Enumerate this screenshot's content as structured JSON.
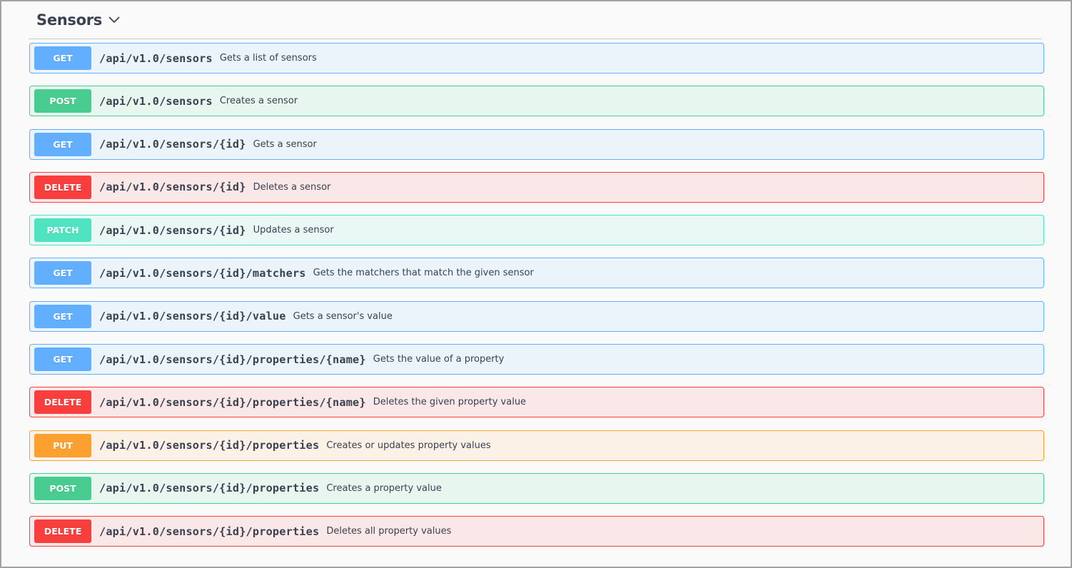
{
  "tag": {
    "title": "Sensors"
  },
  "operations": [
    {
      "method": "GET",
      "path": "/api/v1.0/sensors",
      "summary": "Gets a list of sensors"
    },
    {
      "method": "POST",
      "path": "/api/v1.0/sensors",
      "summary": "Creates a sensor"
    },
    {
      "method": "GET",
      "path": "/api/v1.0/sensors/{id}",
      "summary": "Gets a sensor"
    },
    {
      "method": "DELETE",
      "path": "/api/v1.0/sensors/{id}",
      "summary": "Deletes a sensor"
    },
    {
      "method": "PATCH",
      "path": "/api/v1.0/sensors/{id}",
      "summary": "Updates a sensor"
    },
    {
      "method": "GET",
      "path": "/api/v1.0/sensors/{id}/matchers",
      "summary": "Gets the matchers that match the given sensor"
    },
    {
      "method": "GET",
      "path": "/api/v1.0/sensors/{id}/value",
      "summary": "Gets a sensor's value"
    },
    {
      "method": "GET",
      "path": "/api/v1.0/sensors/{id}/properties/{name}",
      "summary": "Gets the value of a property"
    },
    {
      "method": "DELETE",
      "path": "/api/v1.0/sensors/{id}/properties/{name}",
      "summary": "Deletes the given property value"
    },
    {
      "method": "PUT",
      "path": "/api/v1.0/sensors/{id}/properties",
      "summary": "Creates or updates property values"
    },
    {
      "method": "POST",
      "path": "/api/v1.0/sensors/{id}/properties",
      "summary": "Creates a property value"
    },
    {
      "method": "DELETE",
      "path": "/api/v1.0/sensors/{id}/properties",
      "summary": "Deletes all property values"
    }
  ],
  "colors": {
    "GET": "#61affe",
    "POST": "#49cc90",
    "DELETE": "#f93e3e",
    "PATCH": "#50e3c2",
    "PUT": "#fca130",
    "text": "#3b4151"
  },
  "icons": {
    "collapse": "chevron-down-icon"
  }
}
